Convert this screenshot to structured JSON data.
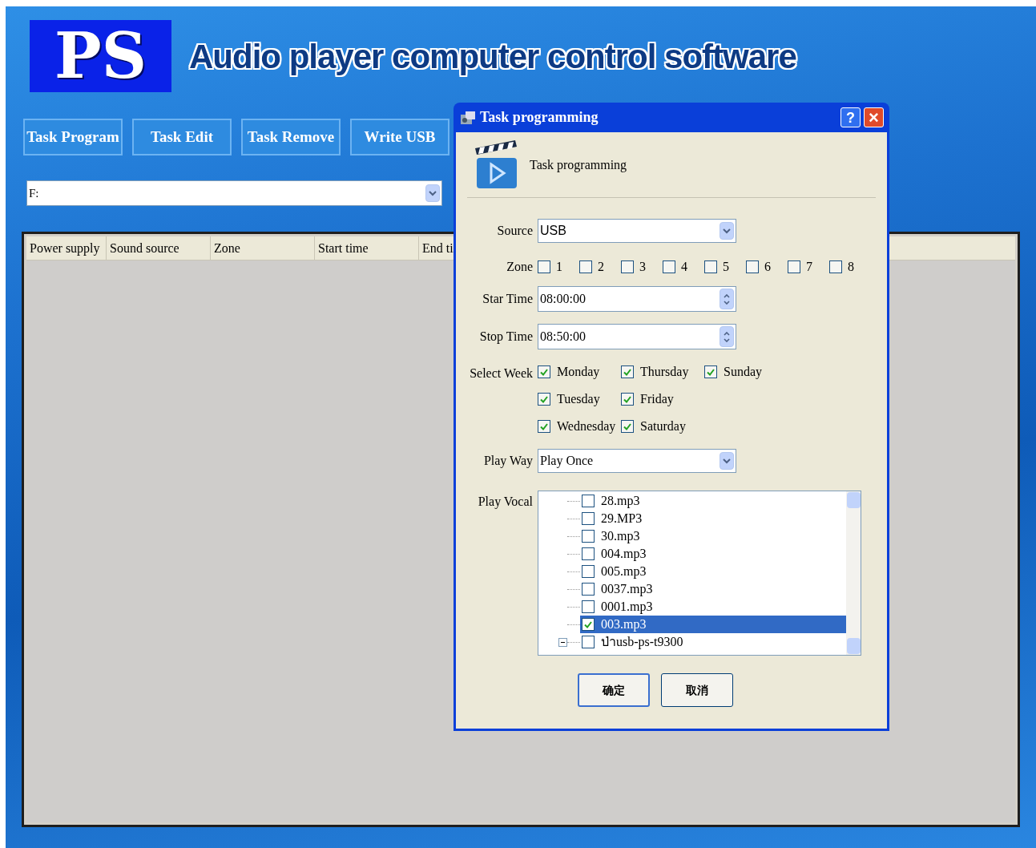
{
  "header": {
    "logo": "PS",
    "title": "Audio player computer control software"
  },
  "toolbar": {
    "buttons": [
      "Task Program",
      "Task Edit",
      "Task Remove",
      "Write USB"
    ]
  },
  "drive_select": {
    "value": "F:"
  },
  "table": {
    "columns": [
      "Power supply",
      "Sound source",
      "Zone",
      "Start time",
      "End ti"
    ]
  },
  "dialog": {
    "title": "Task programming",
    "help": "?",
    "close": "×",
    "heading": "Task programming",
    "source": {
      "label": "Source",
      "value": "USB"
    },
    "zone": {
      "label": "Zone",
      "options": [
        {
          "label": "1",
          "checked": false
        },
        {
          "label": "2",
          "checked": false
        },
        {
          "label": "3",
          "checked": false
        },
        {
          "label": "4",
          "checked": false
        },
        {
          "label": "5",
          "checked": false
        },
        {
          "label": "6",
          "checked": false
        },
        {
          "label": "7",
          "checked": false
        },
        {
          "label": "8",
          "checked": false
        }
      ]
    },
    "start_time": {
      "label": "Star Time",
      "value": "08:00:00"
    },
    "stop_time": {
      "label": "Stop Time",
      "value": "08:50:00"
    },
    "week": {
      "label": "Select Week",
      "days": [
        {
          "label": "Monday",
          "checked": true
        },
        {
          "label": "Tuesday",
          "checked": true
        },
        {
          "label": "Wednesday",
          "checked": true
        },
        {
          "label": "Thursday",
          "checked": true
        },
        {
          "label": "Friday",
          "checked": true
        },
        {
          "label": "Saturday",
          "checked": true
        },
        {
          "label": "Sunday",
          "checked": true
        }
      ]
    },
    "play_way": {
      "label": "Play Way",
      "value": "Play Once"
    },
    "play_vocal": {
      "label": "Play Vocal",
      "items": [
        {
          "kind": "file",
          "label": "28.mp3",
          "checked": false,
          "selected": false
        },
        {
          "kind": "file",
          "label": "29.MP3",
          "checked": false,
          "selected": false
        },
        {
          "kind": "file",
          "label": "30.mp3",
          "checked": false,
          "selected": false
        },
        {
          "kind": "file",
          "label": "004.mp3",
          "checked": false,
          "selected": false
        },
        {
          "kind": "file",
          "label": "005.mp3",
          "checked": false,
          "selected": false
        },
        {
          "kind": "file",
          "label": "0037.mp3",
          "checked": false,
          "selected": false
        },
        {
          "kind": "file",
          "label": "0001.mp3",
          "checked": false,
          "selected": false
        },
        {
          "kind": "file",
          "label": "003.mp3",
          "checked": true,
          "selected": true
        },
        {
          "kind": "folder",
          "label": "ป่าusb-ps-t9300",
          "checked": false,
          "selected": false,
          "expanded": true
        }
      ]
    },
    "buttons": [
      "确定",
      "取消"
    ]
  }
}
